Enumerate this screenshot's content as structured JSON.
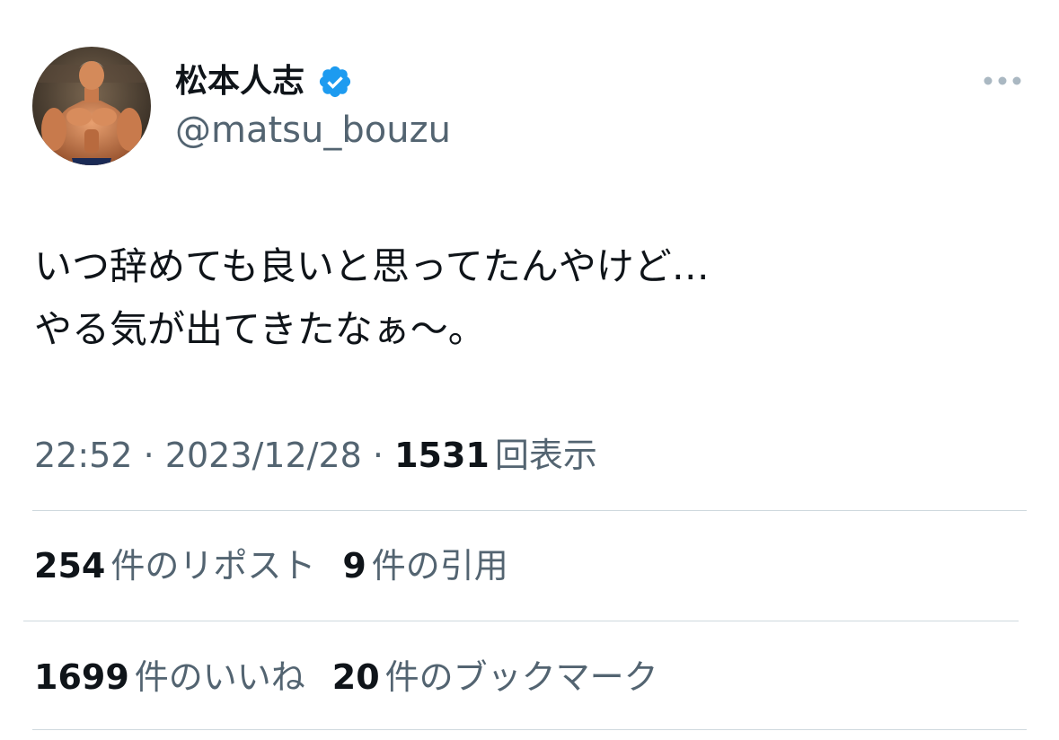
{
  "user": {
    "display_name": "松本人志",
    "handle": "@matsu_bouzu",
    "avatar_icon": "avatar-muscle-figure",
    "verified_icon": "verified-badge-icon",
    "verified_color": "#1d9bf0"
  },
  "tweet": {
    "lines": [
      "いつ辞めても良いと思ってたんやけど…",
      "やる気が出てきたなぁ〜。"
    ]
  },
  "meta": {
    "time": "22:52",
    "separator": "·",
    "date": "2023/12/28",
    "views_count": "1531",
    "views_label": "回表示"
  },
  "stats": {
    "reposts_count": "254",
    "reposts_label": "件のリポスト",
    "quotes_count": "9",
    "quotes_label": "件の引用",
    "likes_count": "1699",
    "likes_label": "件のいいね",
    "bookmarks_count": "20",
    "bookmarks_label": "件のブックマーク"
  },
  "colors": {
    "text_primary": "#0f1419",
    "text_secondary": "#536471",
    "divider": "#cfd9de",
    "accent": "#1d9bf0"
  },
  "icons": {
    "more": "more-horizontal-icon"
  }
}
